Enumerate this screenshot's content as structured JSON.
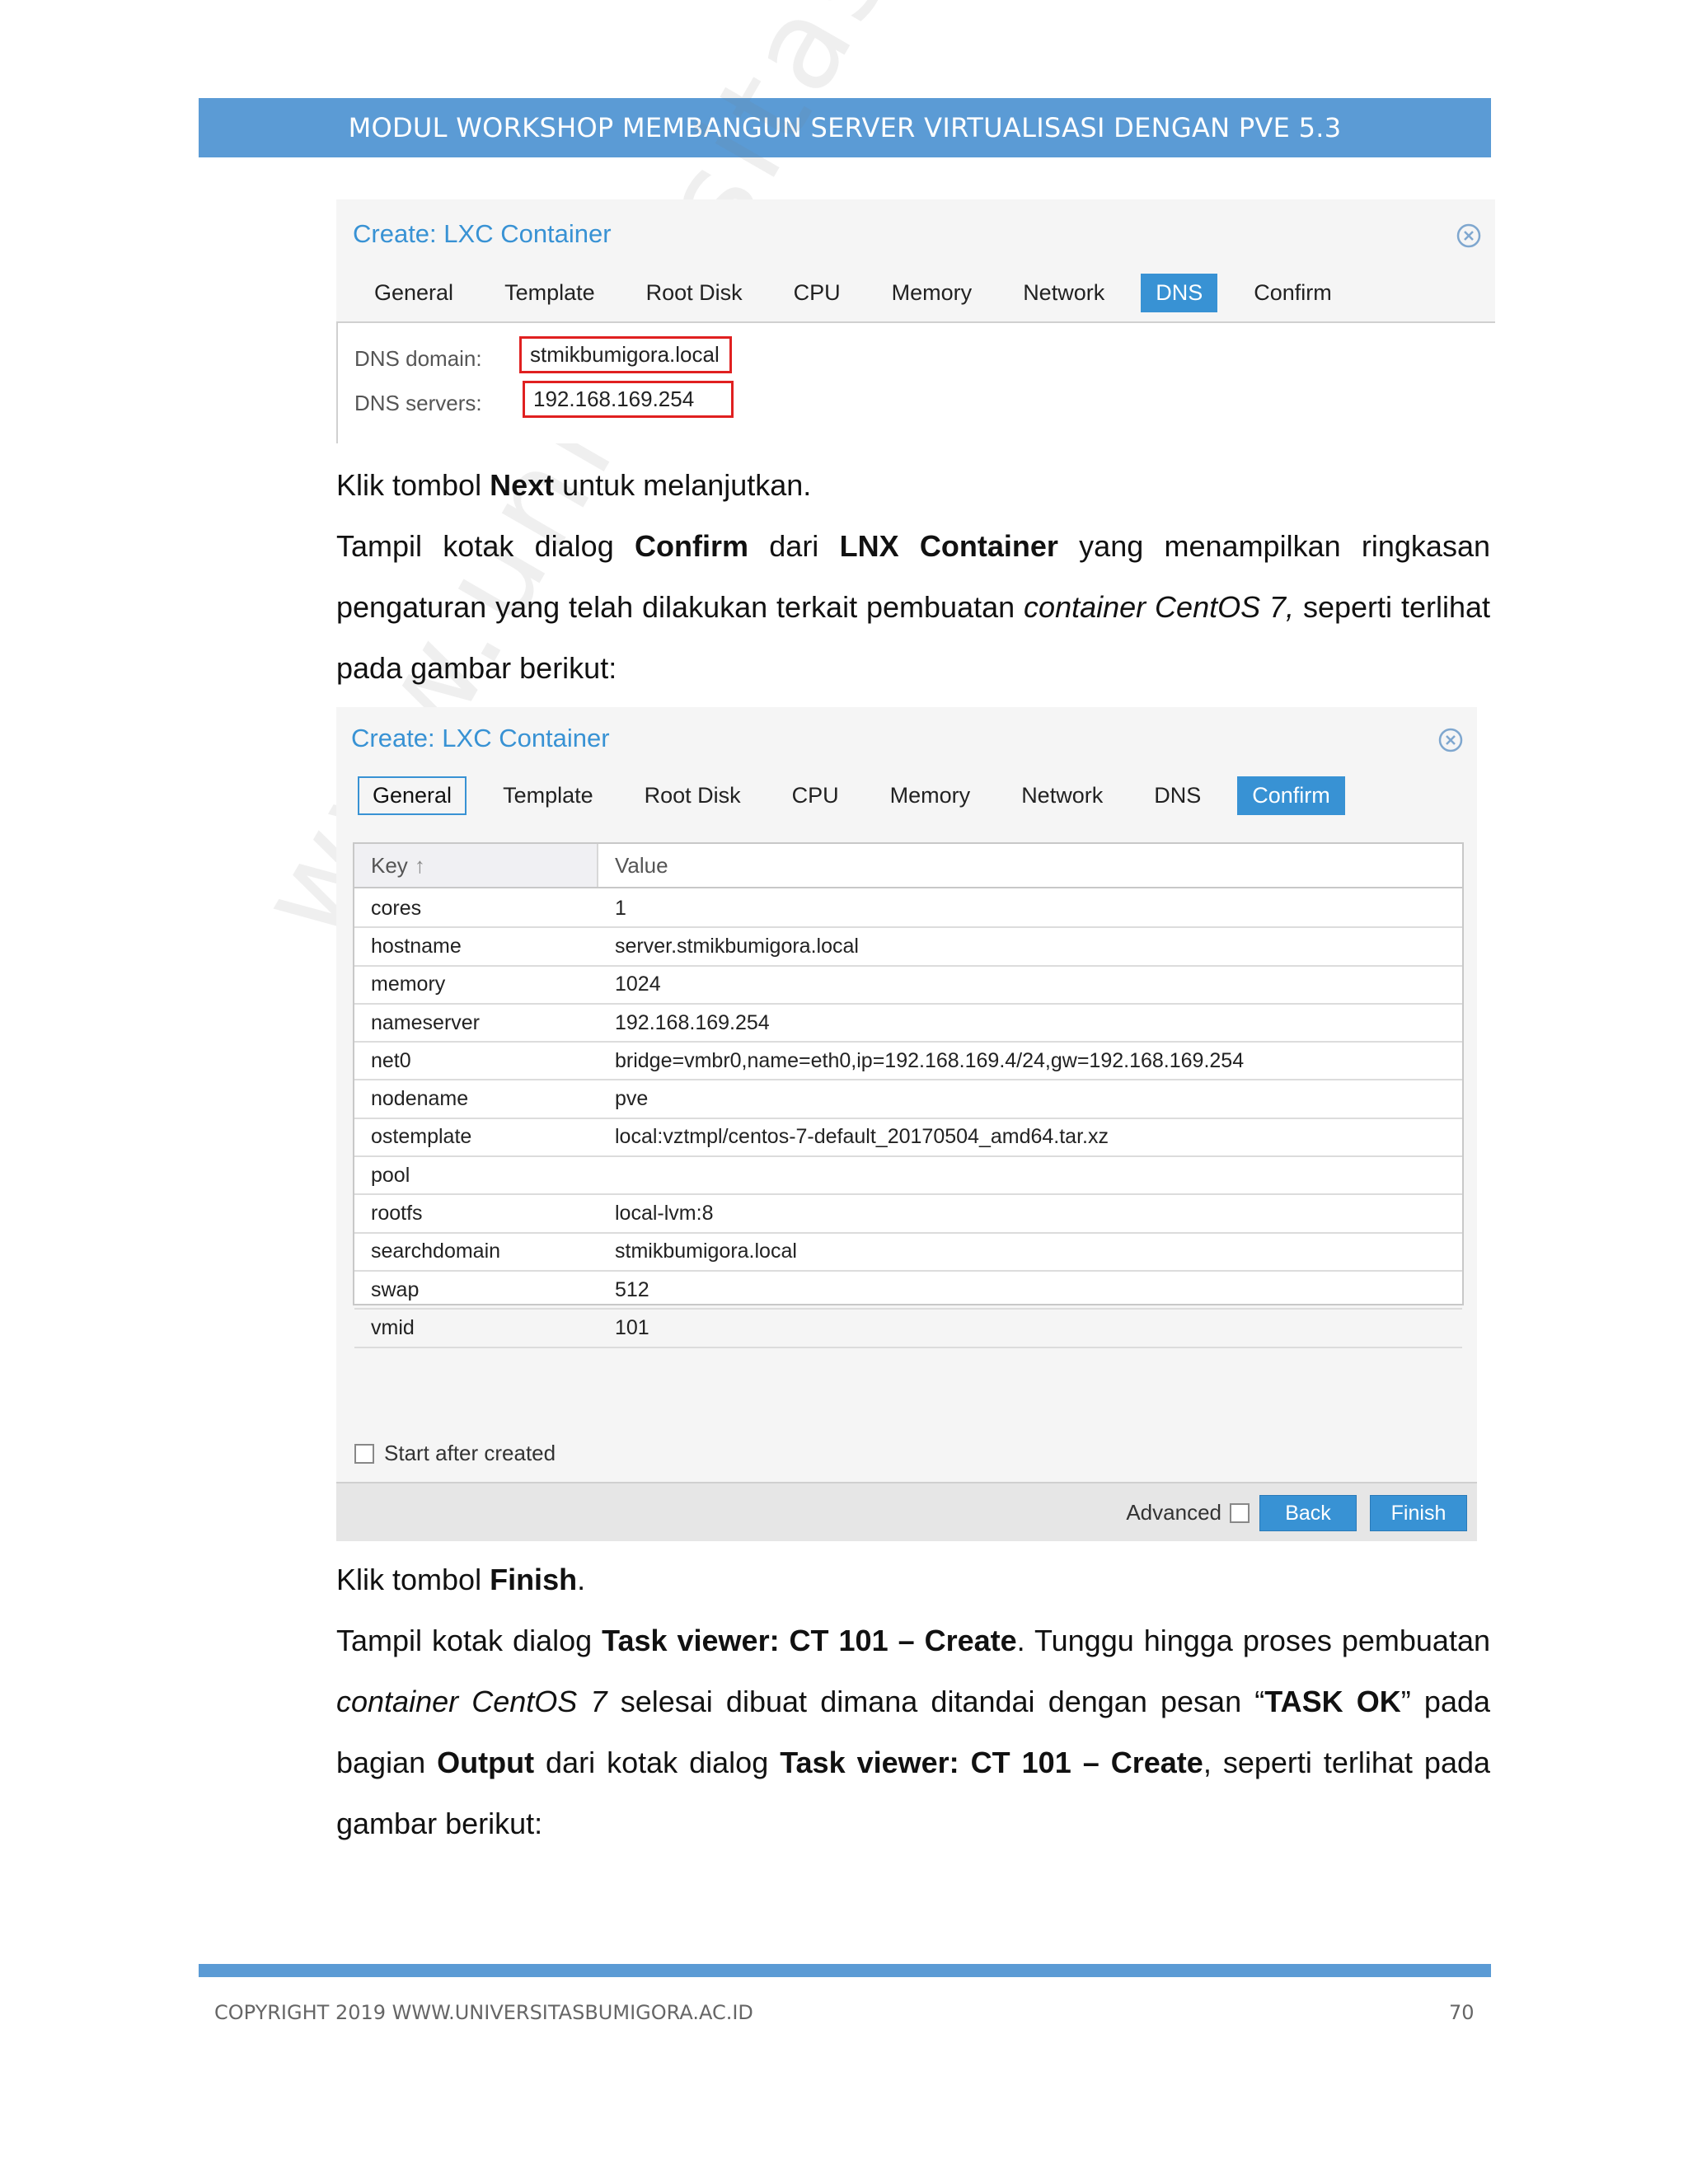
{
  "header": {
    "title": "MODUL WORKSHOP MEMBANGUN SERVER VIRTUALISASI DENGAN PVE 5.3"
  },
  "watermark": {
    "text": "www.universitasbumigora.ac.id"
  },
  "dialog1": {
    "title": "Create: LXC Container",
    "tabs": [
      "General",
      "Template",
      "Root Disk",
      "CPU",
      "Memory",
      "Network",
      "DNS",
      "Confirm"
    ],
    "active_tab": "DNS",
    "dns_domain_label": "DNS domain:",
    "dns_domain_value": "stmikbumigora.local",
    "dns_servers_label": "DNS servers:",
    "dns_servers_value": "192.168.169.254"
  },
  "para1": {
    "a": "Klik tombol ",
    "b": "Next",
    "c": " untuk melanjutkan."
  },
  "para2": {
    "a": "Tampil kotak dialog ",
    "b": "Confirm",
    "c": " dari ",
    "d": "LNX Container",
    "e": " yang menampilkan ringkasan pengaturan yang telah dilakukan terkait pembuatan ",
    "f": "container CentOS 7,",
    "g": " seperti terlihat pada gambar berikut:"
  },
  "dialog2": {
    "title": "Create: LXC Container",
    "tabs": [
      "General",
      "Template",
      "Root Disk",
      "CPU",
      "Memory",
      "Network",
      "DNS",
      "Confirm"
    ],
    "active_tab": "Confirm",
    "outlined_tab": "General",
    "col_key": "Key",
    "col_value": "Value",
    "rows": [
      {
        "key": "cores",
        "value": "1"
      },
      {
        "key": "hostname",
        "value": "server.stmikbumigora.local"
      },
      {
        "key": "memory",
        "value": "1024"
      },
      {
        "key": "nameserver",
        "value": "192.168.169.254"
      },
      {
        "key": "net0",
        "value": "bridge=vmbr0,name=eth0,ip=192.168.169.4/24,gw=192.168.169.254"
      },
      {
        "key": "nodename",
        "value": "pve"
      },
      {
        "key": "ostemplate",
        "value": "local:vztmpl/centos-7-default_20170504_amd64.tar.xz"
      },
      {
        "key": "pool",
        "value": ""
      },
      {
        "key": "rootfs",
        "value": "local-lvm:8"
      },
      {
        "key": "searchdomain",
        "value": "stmikbumigora.local"
      },
      {
        "key": "swap",
        "value": "512"
      },
      {
        "key": "vmid",
        "value": "101"
      }
    ],
    "start_after_created": "Start after created",
    "advanced_label": "Advanced",
    "back_label": "Back",
    "finish_label": "Finish"
  },
  "para3": {
    "a": "Klik tombol ",
    "b": "Finish",
    "c": "."
  },
  "para4": {
    "a": "Tampil kotak dialog ",
    "b": "Task viewer: CT 101 – Create",
    "c": ". Tunggu hingga proses pembuatan ",
    "d": "container CentOS 7",
    "e": " selesai dibuat dimana ditandai dengan pesan “",
    "f": "TASK OK",
    "g": "” pada bagian ",
    "h": "Output",
    "i": " dari kotak dialog ",
    "j": "Task viewer: CT 101 – Create",
    "k": ", seperti terlihat pada gambar berikut:"
  },
  "footer": {
    "copyright": "COPYRIGHT 2019 WWW.UNIVERSITASBUMIGORA.AC.ID",
    "page": "70"
  },
  "colors": {
    "accent_blue": "#5b9bd5",
    "pve_blue": "#3892d4",
    "highlight_red": "#e02020"
  }
}
